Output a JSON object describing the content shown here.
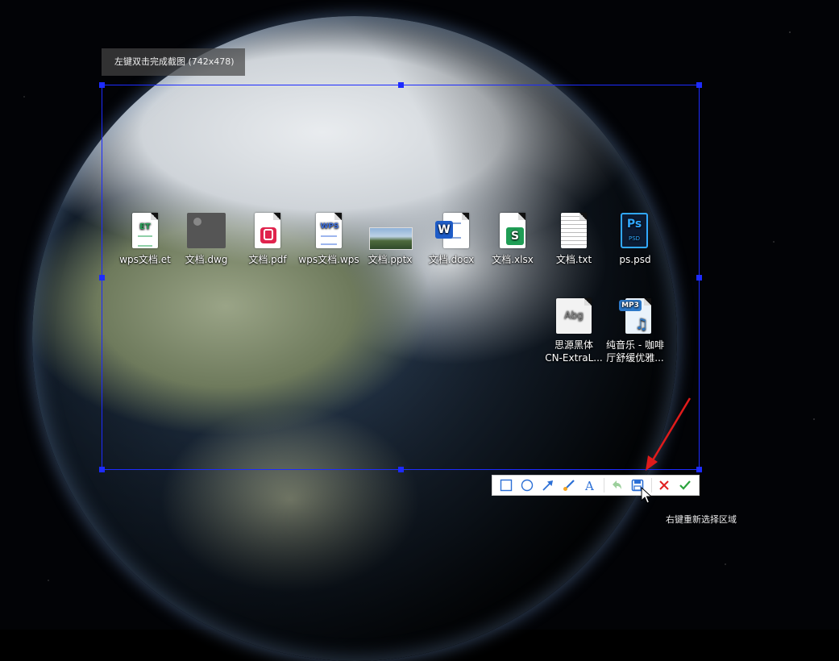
{
  "hints": {
    "top": "左键双击完成截图 (742x478)",
    "bottom": "右键重新选择区域"
  },
  "desktop_icons": [
    {
      "label": "wps文档.et",
      "icon": "et-spreadsheet-icon",
      "badge": "ET"
    },
    {
      "label": "文档.dwg",
      "icon": "dwg-file-icon"
    },
    {
      "label": "文档.pdf",
      "icon": "pdf-file-icon"
    },
    {
      "label": "wps文档.wps",
      "icon": "wps-document-icon",
      "badge": "WPS"
    },
    {
      "label": "文档.pptx",
      "icon": "pptx-thumbnail-icon"
    },
    {
      "label": "文档.docx",
      "icon": "word-document-icon",
      "badge": "W"
    },
    {
      "label": "文档.xlsx",
      "icon": "xlsx-spreadsheet-icon",
      "badge": "S"
    },
    {
      "label": "文档.txt",
      "icon": "text-file-icon"
    },
    {
      "label": "ps.psd",
      "icon": "photoshop-file-icon",
      "badge": "Ps"
    },
    {
      "label_line1": "思源黑体",
      "label_line2": "CN-ExtraL...",
      "icon": "font-file-icon",
      "badge": "Abg"
    },
    {
      "label_line1": "纯音乐 - 咖啡",
      "label_line2": "厅舒缓优雅...",
      "icon": "mp3-file-icon",
      "badge": "MP3"
    }
  ],
  "toolbar": {
    "tools": [
      "rectangle-tool",
      "ellipse-tool",
      "arrow-tool",
      "brush-tool",
      "text-tool",
      "undo-tool",
      "save-tool",
      "cancel-tool",
      "confirm-tool"
    ],
    "colors": {
      "selection": "#1d2bff",
      "accent_blue": "#2b6fd6",
      "cancel": "#e02020",
      "confirm": "#2aa33c"
    }
  }
}
